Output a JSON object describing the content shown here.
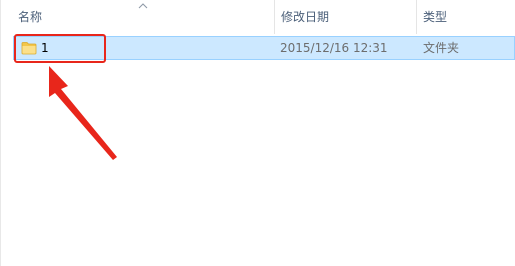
{
  "columns": {
    "name": "名称",
    "date_modified": "修改日期",
    "type": "类型"
  },
  "sort": {
    "column": "name",
    "direction": "ascending"
  },
  "rows": [
    {
      "name": "1",
      "date_modified": "2015/12/16 12:31",
      "type": "文件夹",
      "icon": "folder-icon",
      "selected": true
    }
  ],
  "colors": {
    "selection_background": "#cce8ff",
    "selection_border": "#99d1ff",
    "annotation_red": "#e8261b",
    "header_text": "#4c607a",
    "secondary_text": "#6d6d6d"
  }
}
